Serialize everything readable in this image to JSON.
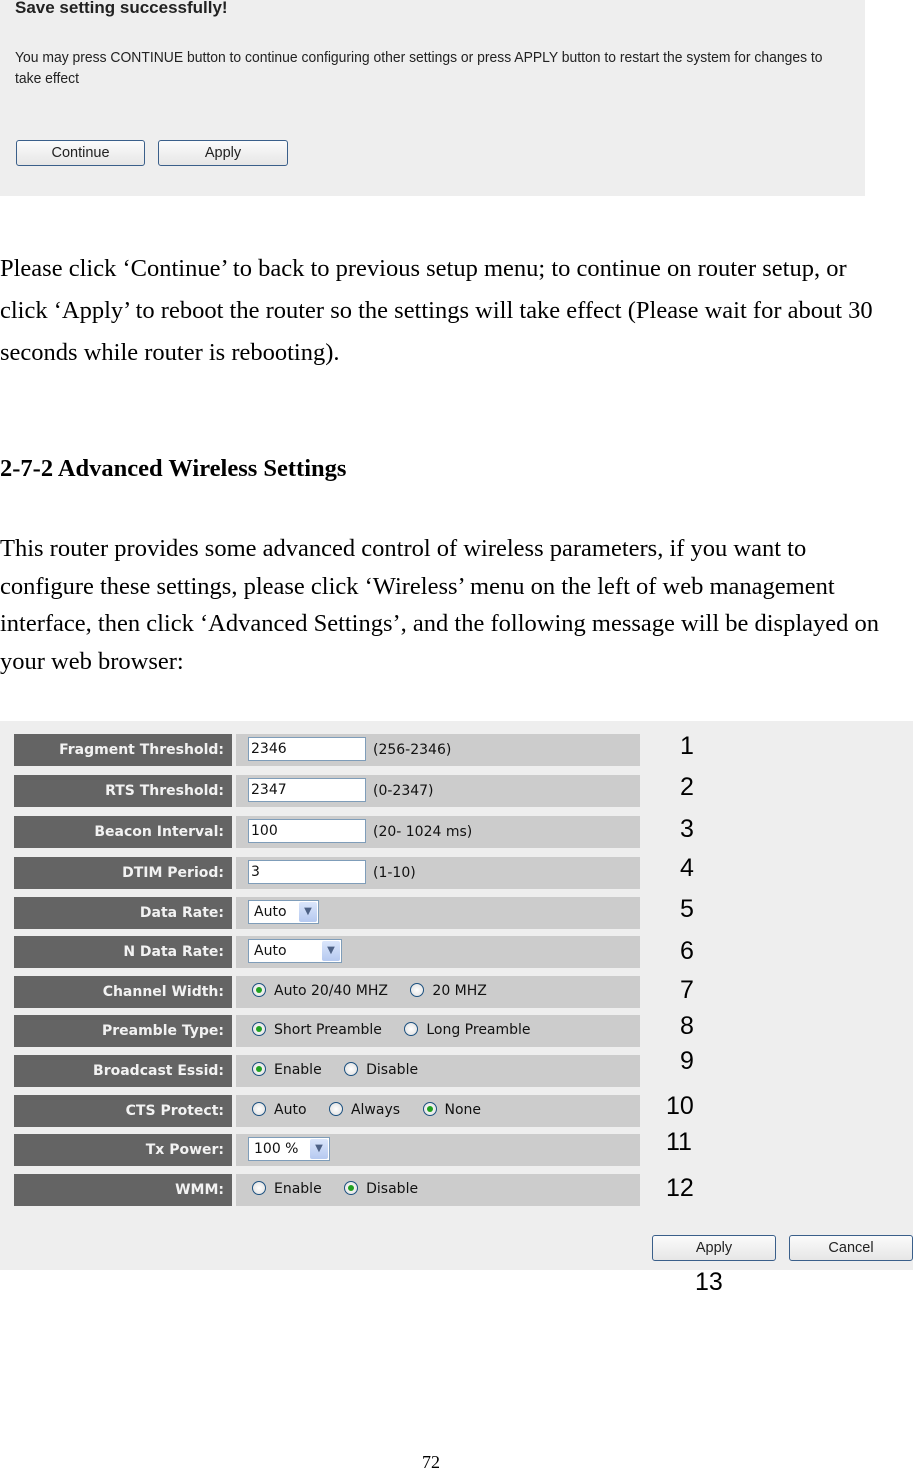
{
  "save_dialog": {
    "title": "Save setting successfully!",
    "message": "You may press CONTINUE button to continue configuring other settings or press APPLY button to restart the system for changes to take effect",
    "continue_label": "Continue",
    "apply_label": "Apply"
  },
  "doc": {
    "para1": "Please click ‘Continue’ to back to previous setup menu; to continue on router setup, or click ‘Apply’ to reboot the router so the settings will take effect (Please wait for about 30 seconds while router is rebooting).",
    "heading": "2-7-2 Advanced Wireless Settings",
    "para2": "This router provides some advanced control of wireless parameters, if you want to configure these settings, please click ‘Wireless’ menu on the left of web management interface, then click ‘Advanced Settings’, and the following message will be displayed on your web browser:",
    "page_number": "72"
  },
  "advanced": {
    "fragment": {
      "label": "Fragment Threshold:",
      "value": "2346",
      "hint": "(256-2346)"
    },
    "rts": {
      "label": "RTS Threshold:",
      "value": "2347",
      "hint": "(0-2347)"
    },
    "beacon": {
      "label": "Beacon Interval:",
      "value": "100",
      "hint": "(20- 1024 ms)"
    },
    "dtim": {
      "label": "DTIM Period:",
      "value": "3",
      "hint": "(1-10)"
    },
    "data_rate": {
      "label": "Data Rate:",
      "selected": "Auto"
    },
    "n_data_rate": {
      "label": "N Data Rate:",
      "selected": "Auto"
    },
    "channel_width": {
      "label": "Channel Width:",
      "options": [
        "Auto 20/40 MHZ",
        "20 MHZ"
      ],
      "selected": "Auto 20/40 MHZ"
    },
    "preamble": {
      "label": "Preamble Type:",
      "options": [
        "Short Preamble",
        "Long Preamble"
      ],
      "selected": "Short Preamble"
    },
    "broadcast_essid": {
      "label": "Broadcast Essid:",
      "options": [
        "Enable",
        "Disable"
      ],
      "selected": "Enable"
    },
    "cts_protect": {
      "label": "CTS Protect:",
      "options": [
        "Auto",
        "Always",
        "None"
      ],
      "selected": "None"
    },
    "tx_power": {
      "label": "Tx Power:",
      "selected": "100 %"
    },
    "wmm": {
      "label": "WMM:",
      "options": [
        "Enable",
        "Disable"
      ],
      "selected": "Disable"
    },
    "apply_label": "Apply",
    "cancel_label": "Cancel"
  },
  "callouts": [
    "1",
    "2",
    "3",
    "4",
    "5",
    "6",
    "7",
    "8",
    "9",
    "10",
    "11",
    "12",
    "13"
  ]
}
